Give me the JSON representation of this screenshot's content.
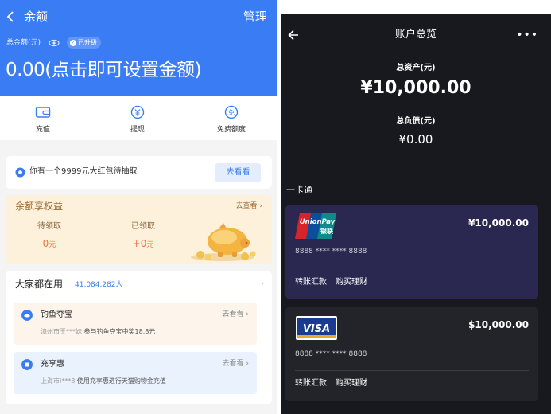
{
  "left": {
    "header": {
      "title": "余额",
      "manage": "管理",
      "total_label": "总金额(元)",
      "upgraded_badge": "已升级",
      "amount_text": "0.00(点击即可设置金额)"
    },
    "actions": [
      {
        "label": "充值",
        "icon": "wallet-icon"
      },
      {
        "label": "提现",
        "icon": "yuan-withdraw-icon"
      },
      {
        "label": "免费额度",
        "icon": "free-quota-icon"
      }
    ],
    "promo": {
      "text": "你有一个9999元大红包待抽取",
      "button": "去看看"
    },
    "rights": {
      "title": "余额享权益",
      "more": "去查看",
      "pending_label": "待领取",
      "pending_value": "0",
      "received_label": "已领取",
      "received_value": "+0",
      "unit": "元"
    },
    "popular": {
      "title": "大家都在用",
      "count": "41,084,282人",
      "items": [
        {
          "name": "钓鱼夺宝",
          "more": "去看看",
          "user": "漳州市王***妹",
          "desc": "参与钓鱼夺宝中奖18.8元"
        },
        {
          "name": "充享惠",
          "more": "去看看",
          "user": "上海市i***8",
          "desc": "使用充享惠进行天猫购物金充值"
        }
      ]
    }
  },
  "right": {
    "header": {
      "title": "账户总览",
      "more": "•••"
    },
    "assets_label": "总资产(元)",
    "assets_value": "¥10,000.00",
    "liabilities_label": "总负债(元)",
    "liabilities_value": "¥0.00",
    "section_title": "一卡通",
    "cards": [
      {
        "brand": "UnionPay 银联",
        "balance": "¥10,000.00",
        "number": "8888 **** **** 8888",
        "actions": [
          "转账汇款",
          "购买理财"
        ]
      },
      {
        "brand": "VISA",
        "balance": "$10,000.00",
        "number": "8888 **** **** 8888",
        "actions": [
          "转账汇款",
          "购买理财"
        ]
      }
    ]
  },
  "colors": {
    "primary_blue": "#3a7cf4",
    "orange": "#f07242",
    "dark_bg": "#17191f",
    "unionpay_card": "#2a2850"
  }
}
